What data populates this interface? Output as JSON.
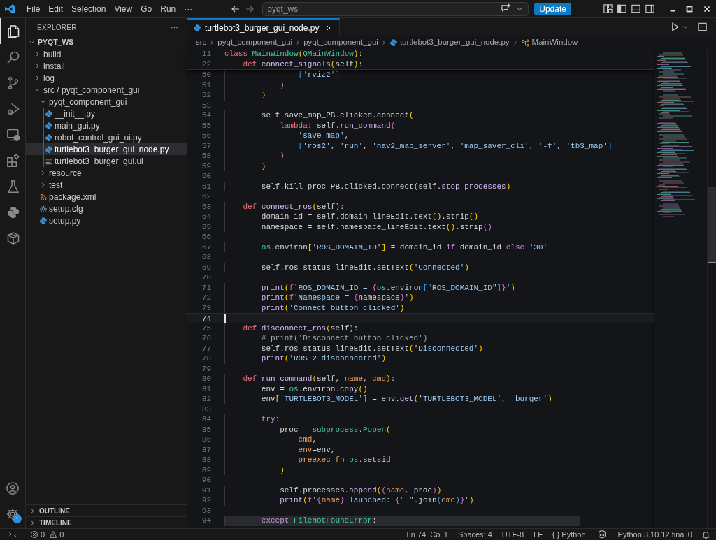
{
  "title_bar": {
    "menu": [
      "File",
      "Edit",
      "Selection",
      "View",
      "Go",
      "Run",
      "···"
    ],
    "search": "pyqt_ws",
    "update_button": "Update"
  },
  "activity_bar": {
    "items": [
      {
        "kind": "explorer",
        "selected": true
      },
      {
        "kind": "search",
        "selected": false
      },
      {
        "kind": "source-control",
        "selected": false
      },
      {
        "kind": "run-debug",
        "selected": false
      },
      {
        "kind": "remote",
        "selected": false
      },
      {
        "kind": "extensions",
        "selected": false
      },
      {
        "kind": "testing",
        "selected": false
      },
      {
        "kind": "python",
        "selected": false
      },
      {
        "kind": "box",
        "selected": false
      }
    ],
    "settings_badge": "1"
  },
  "explorer": {
    "title": "EXPLORER",
    "more": "···",
    "tree": [
      {
        "label": "PYQT_WS",
        "kind": "root",
        "expanded": true,
        "selected": false,
        "children": [
          {
            "label": "build",
            "kind": "folder",
            "expanded": false,
            "selected": false
          },
          {
            "label": "install",
            "kind": "folder",
            "expanded": false,
            "selected": false
          },
          {
            "label": "log",
            "kind": "folder",
            "expanded": false,
            "selected": false
          },
          {
            "label": "src / pyqt_component_gui",
            "kind": "folder",
            "expanded": true,
            "selected": false,
            "children": [
              {
                "label": "pyqt_component_gui",
                "kind": "folder",
                "expanded": true,
                "selected": false,
                "children": [
                  {
                    "label": "__init__.py",
                    "kind": "python",
                    "selected": false
                  },
                  {
                    "label": "main_gui.py",
                    "kind": "python",
                    "selected": false
                  },
                  {
                    "label": "robot_control_gui_ui.py",
                    "kind": "python",
                    "selected": false
                  },
                  {
                    "label": "turtlebot3_burger_gui_node.py",
                    "kind": "python",
                    "selected": true
                  },
                  {
                    "label": "turtlebot3_burger_gui.ui",
                    "kind": "ui",
                    "selected": false
                  }
                ]
              },
              {
                "label": "resource",
                "kind": "folder",
                "expanded": false,
                "selected": false
              },
              {
                "label": "test",
                "kind": "folder",
                "expanded": false,
                "selected": false
              },
              {
                "label": "package.xml",
                "kind": "xml",
                "selected": false
              },
              {
                "label": "setup.cfg",
                "kind": "cfg",
                "selected": false
              },
              {
                "label": "setup.py",
                "kind": "python",
                "selected": false
              }
            ]
          }
        ]
      }
    ],
    "sections": [
      {
        "label": "OUTLINE",
        "expanded": false
      },
      {
        "label": "TIMELINE",
        "expanded": false
      }
    ]
  },
  "editor": {
    "tabs": [
      {
        "label": "turtlebot3_burger_gui_node.py",
        "kind": "python",
        "selected": true
      }
    ],
    "breadcrumbs": [
      {
        "label": "src",
        "kind": "folder"
      },
      {
        "label": "pyqt_component_gui",
        "kind": "folder"
      },
      {
        "label": "pyqt_component_gui",
        "kind": "folder"
      },
      {
        "label": "turtlebot3_burger_gui_node.py",
        "kind": "python"
      },
      {
        "label": "MainWindow",
        "kind": "class"
      }
    ],
    "lines": [
      {
        "number": "11",
        "kind": "sticky",
        "tokens": [
          {
            "text": "class ",
            "kind": "keyword"
          },
          {
            "text": "MainWindow",
            "kind": "type"
          },
          {
            "text": "(",
            "kind": "bracket1"
          },
          {
            "text": "QMainWindow",
            "kind": "type"
          },
          {
            "text": ")",
            "kind": "bracket1"
          },
          {
            "text": ":",
            "kind": "plain"
          }
        ]
      },
      {
        "number": "22",
        "kind": "sticky",
        "tokens": [
          {
            "text": "    def ",
            "kind": "keyword"
          },
          {
            "text": "connect_signals",
            "kind": "function"
          },
          {
            "text": "(",
            "kind": "bracket1"
          },
          {
            "text": "self",
            "kind": "plain"
          },
          {
            "text": ")",
            "kind": "bracket1"
          },
          {
            "text": ":",
            "kind": "plain"
          }
        ]
      },
      {
        "number": "50",
        "kind": "normal",
        "tokens": [
          {
            "text": "                [",
            "kind": "bracket3"
          },
          {
            "text": "'rviz2'",
            "kind": "string"
          },
          {
            "text": "]",
            "kind": "bracket3"
          }
        ]
      },
      {
        "number": "51",
        "kind": "normal",
        "tokens": [
          {
            "text": "            )",
            "kind": "bracket2"
          }
        ]
      },
      {
        "number": "52",
        "kind": "normal",
        "tokens": [
          {
            "text": "        )",
            "kind": "bracket1"
          }
        ]
      },
      {
        "number": "53",
        "kind": "normal"
      },
      {
        "number": "54",
        "kind": "normal",
        "tokens": [
          {
            "text": "        self.save_map_PB.clicked.connect",
            "kind": "plain"
          },
          {
            "text": "(",
            "kind": "bracket1"
          }
        ]
      },
      {
        "number": "55",
        "kind": "normal",
        "tokens": [
          {
            "text": "            lambda",
            "kind": "keyword"
          },
          {
            "text": ": self.",
            "kind": "plain"
          },
          {
            "text": "run_command",
            "kind": "function"
          },
          {
            "text": "(",
            "kind": "bracket2"
          }
        ]
      },
      {
        "number": "56",
        "kind": "normal",
        "tokens": [
          {
            "text": "                'save_map'",
            "kind": "string"
          },
          {
            "text": ",",
            "kind": "plain"
          }
        ]
      },
      {
        "number": "57",
        "kind": "normal",
        "tokens": [
          {
            "text": "                [",
            "kind": "bracket3"
          },
          {
            "text": "'ros2'",
            "kind": "string"
          },
          {
            "text": ", ",
            "kind": "plain"
          },
          {
            "text": "'run'",
            "kind": "string"
          },
          {
            "text": ", ",
            "kind": "plain"
          },
          {
            "text": "'nav2_map_server'",
            "kind": "string"
          },
          {
            "text": ", ",
            "kind": "plain"
          },
          {
            "text": "'map_saver_cli'",
            "kind": "string"
          },
          {
            "text": ", ",
            "kind": "plain"
          },
          {
            "text": "'-f'",
            "kind": "string"
          },
          {
            "text": ", ",
            "kind": "plain"
          },
          {
            "text": "'tb3_map'",
            "kind": "string"
          },
          {
            "text": "]",
            "kind": "bracket3"
          }
        ]
      },
      {
        "number": "58",
        "kind": "normal",
        "tokens": [
          {
            "text": "            )",
            "kind": "bracket2"
          }
        ]
      },
      {
        "number": "59",
        "kind": "normal",
        "tokens": [
          {
            "text": "        )",
            "kind": "bracket1"
          }
        ]
      },
      {
        "number": "60",
        "kind": "normal"
      },
      {
        "number": "61",
        "kind": "normal",
        "tokens": [
          {
            "text": "        self.kill_proc_PB.clicked.connect",
            "kind": "plain"
          },
          {
            "text": "(",
            "kind": "bracket1"
          },
          {
            "text": "self.",
            "kind": "plain"
          },
          {
            "text": "stop_processes",
            "kind": "function"
          },
          {
            "text": ")",
            "kind": "bracket1"
          }
        ]
      },
      {
        "number": "62",
        "kind": "normal"
      },
      {
        "number": "63",
        "kind": "normal",
        "tokens": [
          {
            "text": "    def ",
            "kind": "keyword"
          },
          {
            "text": "connect_ros",
            "kind": "function"
          },
          {
            "text": "(",
            "kind": "bracket1"
          },
          {
            "text": "self",
            "kind": "plain"
          },
          {
            "text": ")",
            "kind": "bracket1"
          },
          {
            "text": ":",
            "kind": "plain"
          }
        ]
      },
      {
        "number": "64",
        "kind": "normal",
        "tokens": [
          {
            "text": "        domain_id = self.domain_lineEdit.text",
            "kind": "plain"
          },
          {
            "text": "()",
            "kind": "bracket1"
          },
          {
            "text": ".strip",
            "kind": "plain"
          },
          {
            "text": "()",
            "kind": "bracket1"
          }
        ]
      },
      {
        "number": "65",
        "kind": "normal",
        "tokens": [
          {
            "text": "        namespace = self.namespace_lineEdit.text",
            "kind": "plain"
          },
          {
            "text": "()",
            "kind": "bracket1"
          },
          {
            "text": ".strip",
            "kind": "plain"
          },
          {
            "text": "()",
            "kind": "bracket2"
          }
        ]
      },
      {
        "number": "66",
        "kind": "normal"
      },
      {
        "number": "67",
        "kind": "normal",
        "tokens": [
          {
            "text": "        os",
            "kind": "type"
          },
          {
            "text": ".environ",
            "kind": "plain"
          },
          {
            "text": "[",
            "kind": "bracket1"
          },
          {
            "text": "'ROS_DOMAIN_ID'",
            "kind": "string"
          },
          {
            "text": "]",
            "kind": "bracket1"
          },
          {
            "text": " = domain_id ",
            "kind": "plain"
          },
          {
            "text": "if",
            "kind": "control"
          },
          {
            "text": " domain_id ",
            "kind": "plain"
          },
          {
            "text": "else",
            "kind": "control"
          },
          {
            "text": " '30'",
            "kind": "string"
          }
        ]
      },
      {
        "number": "68",
        "kind": "normal"
      },
      {
        "number": "69",
        "kind": "normal",
        "tokens": [
          {
            "text": "        self.ros_status_lineEdit.setText",
            "kind": "plain"
          },
          {
            "text": "(",
            "kind": "bracket1"
          },
          {
            "text": "'Connected'",
            "kind": "string"
          },
          {
            "text": ")",
            "kind": "bracket1"
          }
        ]
      },
      {
        "number": "70",
        "kind": "normal"
      },
      {
        "number": "71",
        "kind": "normal",
        "tokens": [
          {
            "text": "        print",
            "kind": "function"
          },
          {
            "text": "(",
            "kind": "bracket1"
          },
          {
            "text": "f",
            "kind": "keyword"
          },
          {
            "text": "'ROS_DOMAIN_ID = ",
            "kind": "string"
          },
          {
            "text": "{",
            "kind": "bracket2"
          },
          {
            "text": "os",
            "kind": "type"
          },
          {
            "text": ".environ",
            "kind": "plain"
          },
          {
            "text": "[",
            "kind": "bracket3"
          },
          {
            "text": "\"ROS_DOMAIN_ID\"",
            "kind": "string"
          },
          {
            "text": "]",
            "kind": "bracket3"
          },
          {
            "text": "}",
            "kind": "bracket2"
          },
          {
            "text": "'",
            "kind": "string"
          },
          {
            "text": ")",
            "kind": "bracket1"
          }
        ]
      },
      {
        "number": "72",
        "kind": "normal",
        "tokens": [
          {
            "text": "        print",
            "kind": "function"
          },
          {
            "text": "(",
            "kind": "bracket1"
          },
          {
            "text": "f",
            "kind": "keyword"
          },
          {
            "text": "'Namespace = ",
            "kind": "string"
          },
          {
            "text": "{",
            "kind": "bracket2"
          },
          {
            "text": "namespace",
            "kind": "plain"
          },
          {
            "text": "}",
            "kind": "bracket2"
          },
          {
            "text": "'",
            "kind": "string"
          },
          {
            "text": ")",
            "kind": "bracket1"
          }
        ]
      },
      {
        "number": "73",
        "kind": "normal",
        "tokens": [
          {
            "text": "        print",
            "kind": "function"
          },
          {
            "text": "(",
            "kind": "bracket1"
          },
          {
            "text": "'Connect button clicked'",
            "kind": "string"
          },
          {
            "text": ")",
            "kind": "bracket1"
          }
        ]
      },
      {
        "number": "74",
        "kind": "current"
      },
      {
        "number": "75",
        "kind": "normal",
        "tokens": [
          {
            "text": "    def ",
            "kind": "keyword"
          },
          {
            "text": "disconnect_ros",
            "kind": "function"
          },
          {
            "text": "(",
            "kind": "bracket1"
          },
          {
            "text": "self",
            "kind": "plain"
          },
          {
            "text": ")",
            "kind": "bracket1"
          },
          {
            "text": ":",
            "kind": "plain"
          }
        ]
      },
      {
        "number": "76",
        "kind": "normal",
        "tokens": [
          {
            "text": "        # print('Disconnect button clicked')",
            "kind": "comment"
          }
        ]
      },
      {
        "number": "77",
        "kind": "normal",
        "tokens": [
          {
            "text": "        self.ros_status_lineEdit.setText",
            "kind": "plain"
          },
          {
            "text": "(",
            "kind": "bracket1"
          },
          {
            "text": "'Disconnected'",
            "kind": "string"
          },
          {
            "text": ")",
            "kind": "bracket1"
          }
        ]
      },
      {
        "number": "78",
        "kind": "normal",
        "tokens": [
          {
            "text": "        print",
            "kind": "function"
          },
          {
            "text": "(",
            "kind": "bracket1"
          },
          {
            "text": "'ROS 2 disconnected'",
            "kind": "string"
          },
          {
            "text": ")",
            "kind": "bracket1"
          }
        ]
      },
      {
        "number": "79",
        "kind": "normal"
      },
      {
        "number": "80",
        "kind": "normal",
        "tokens": [
          {
            "text": "    def ",
            "kind": "keyword"
          },
          {
            "text": "run_command",
            "kind": "function"
          },
          {
            "text": "(",
            "kind": "bracket1"
          },
          {
            "text": "self, ",
            "kind": "plain"
          },
          {
            "text": "name",
            "kind": "param"
          },
          {
            "text": ", ",
            "kind": "plain"
          },
          {
            "text": "cmd",
            "kind": "param"
          },
          {
            "text": ")",
            "kind": "bracket1"
          },
          {
            "text": ":",
            "kind": "plain"
          }
        ]
      },
      {
        "number": "81",
        "kind": "normal",
        "tokens": [
          {
            "text": "        env = ",
            "kind": "plain"
          },
          {
            "text": "os",
            "kind": "type"
          },
          {
            "text": ".environ.",
            "kind": "plain"
          },
          {
            "text": "copy",
            "kind": "function"
          },
          {
            "text": "()",
            "kind": "bracket1"
          }
        ]
      },
      {
        "number": "82",
        "kind": "normal",
        "tokens": [
          {
            "text": "        env",
            "kind": "plain"
          },
          {
            "text": "[",
            "kind": "bracket1"
          },
          {
            "text": "'TURTLEBOT3_MODEL'",
            "kind": "string"
          },
          {
            "text": "]",
            "kind": "bracket1"
          },
          {
            "text": " = env.",
            "kind": "plain"
          },
          {
            "text": "get",
            "kind": "function"
          },
          {
            "text": "(",
            "kind": "bracket1"
          },
          {
            "text": "'TURTLEBOT3_MODEL'",
            "kind": "string"
          },
          {
            "text": ", ",
            "kind": "plain"
          },
          {
            "text": "'burger'",
            "kind": "string"
          },
          {
            "text": ")",
            "kind": "bracket1"
          }
        ]
      },
      {
        "number": "83",
        "kind": "normal"
      },
      {
        "number": "84",
        "kind": "normal",
        "tokens": [
          {
            "text": "        try",
            "kind": "control"
          },
          {
            "text": ":",
            "kind": "plain"
          }
        ]
      },
      {
        "number": "85",
        "kind": "normal",
        "tokens": [
          {
            "text": "            proc = ",
            "kind": "plain"
          },
          {
            "text": "subprocess",
            "kind": "type"
          },
          {
            "text": ".",
            "kind": "plain"
          },
          {
            "text": "Popen",
            "kind": "type"
          },
          {
            "text": "(",
            "kind": "bracket1"
          }
        ]
      },
      {
        "number": "86",
        "kind": "normal",
        "tokens": [
          {
            "text": "                cmd",
            "kind": "param"
          },
          {
            "text": ",",
            "kind": "plain"
          }
        ]
      },
      {
        "number": "87",
        "kind": "normal",
        "tokens": [
          {
            "text": "                env",
            "kind": "param"
          },
          {
            "text": "=env,",
            "kind": "plain"
          }
        ]
      },
      {
        "number": "88",
        "kind": "normal",
        "tokens": [
          {
            "text": "                preexec_fn",
            "kind": "param"
          },
          {
            "text": "=",
            "kind": "plain"
          },
          {
            "text": "os",
            "kind": "type"
          },
          {
            "text": ".",
            "kind": "plain"
          },
          {
            "text": "setsid",
            "kind": "function"
          }
        ]
      },
      {
        "number": "89",
        "kind": "normal",
        "tokens": [
          {
            "text": "            )",
            "kind": "bracket1"
          }
        ]
      },
      {
        "number": "90",
        "kind": "normal"
      },
      {
        "number": "91",
        "kind": "normal",
        "tokens": [
          {
            "text": "            self.processes.",
            "kind": "plain"
          },
          {
            "text": "append",
            "kind": "function"
          },
          {
            "text": "(",
            "kind": "bracket1"
          },
          {
            "text": "(",
            "kind": "bracket2"
          },
          {
            "text": "name",
            "kind": "param"
          },
          {
            "text": ", proc",
            "kind": "plain"
          },
          {
            "text": ")",
            "kind": "bracket2"
          },
          {
            "text": ")",
            "kind": "bracket1"
          }
        ]
      },
      {
        "number": "92",
        "kind": "normal",
        "tokens": [
          {
            "text": "            print",
            "kind": "function"
          },
          {
            "text": "(",
            "kind": "bracket1"
          },
          {
            "text": "f",
            "kind": "keyword"
          },
          {
            "text": "'",
            "kind": "string"
          },
          {
            "text": "{",
            "kind": "bracket2"
          },
          {
            "text": "name",
            "kind": "param"
          },
          {
            "text": "}",
            "kind": "bracket2"
          },
          {
            "text": " launched: ",
            "kind": "string"
          },
          {
            "text": "{",
            "kind": "bracket2"
          },
          {
            "text": "\" \"",
            "kind": "string"
          },
          {
            "text": ".join",
            "kind": "plain"
          },
          {
            "text": "(",
            "kind": "bracket3"
          },
          {
            "text": "cmd",
            "kind": "param"
          },
          {
            "text": ")",
            "kind": "bracket3"
          },
          {
            "text": "}",
            "kind": "bracket2"
          },
          {
            "text": "'",
            "kind": "string"
          },
          {
            "text": ")",
            "kind": "bracket1"
          }
        ]
      },
      {
        "number": "93",
        "kind": "normal"
      },
      {
        "number": "94",
        "kind": "shaded",
        "tokens": [
          {
            "text": "        except ",
            "kind": "control"
          },
          {
            "text": "FileNotFoundError",
            "kind": "type"
          },
          {
            "text": ":",
            "kind": "plain"
          }
        ]
      }
    ]
  },
  "status_bar": {
    "errors": "0",
    "warnings": "0",
    "items": [
      "Ln 74, Col 1",
      "Spaces: 4",
      "UTF-8",
      "LF",
      "{ } Python"
    ],
    "interpreter": "Python 3.10.12.final.0"
  }
}
